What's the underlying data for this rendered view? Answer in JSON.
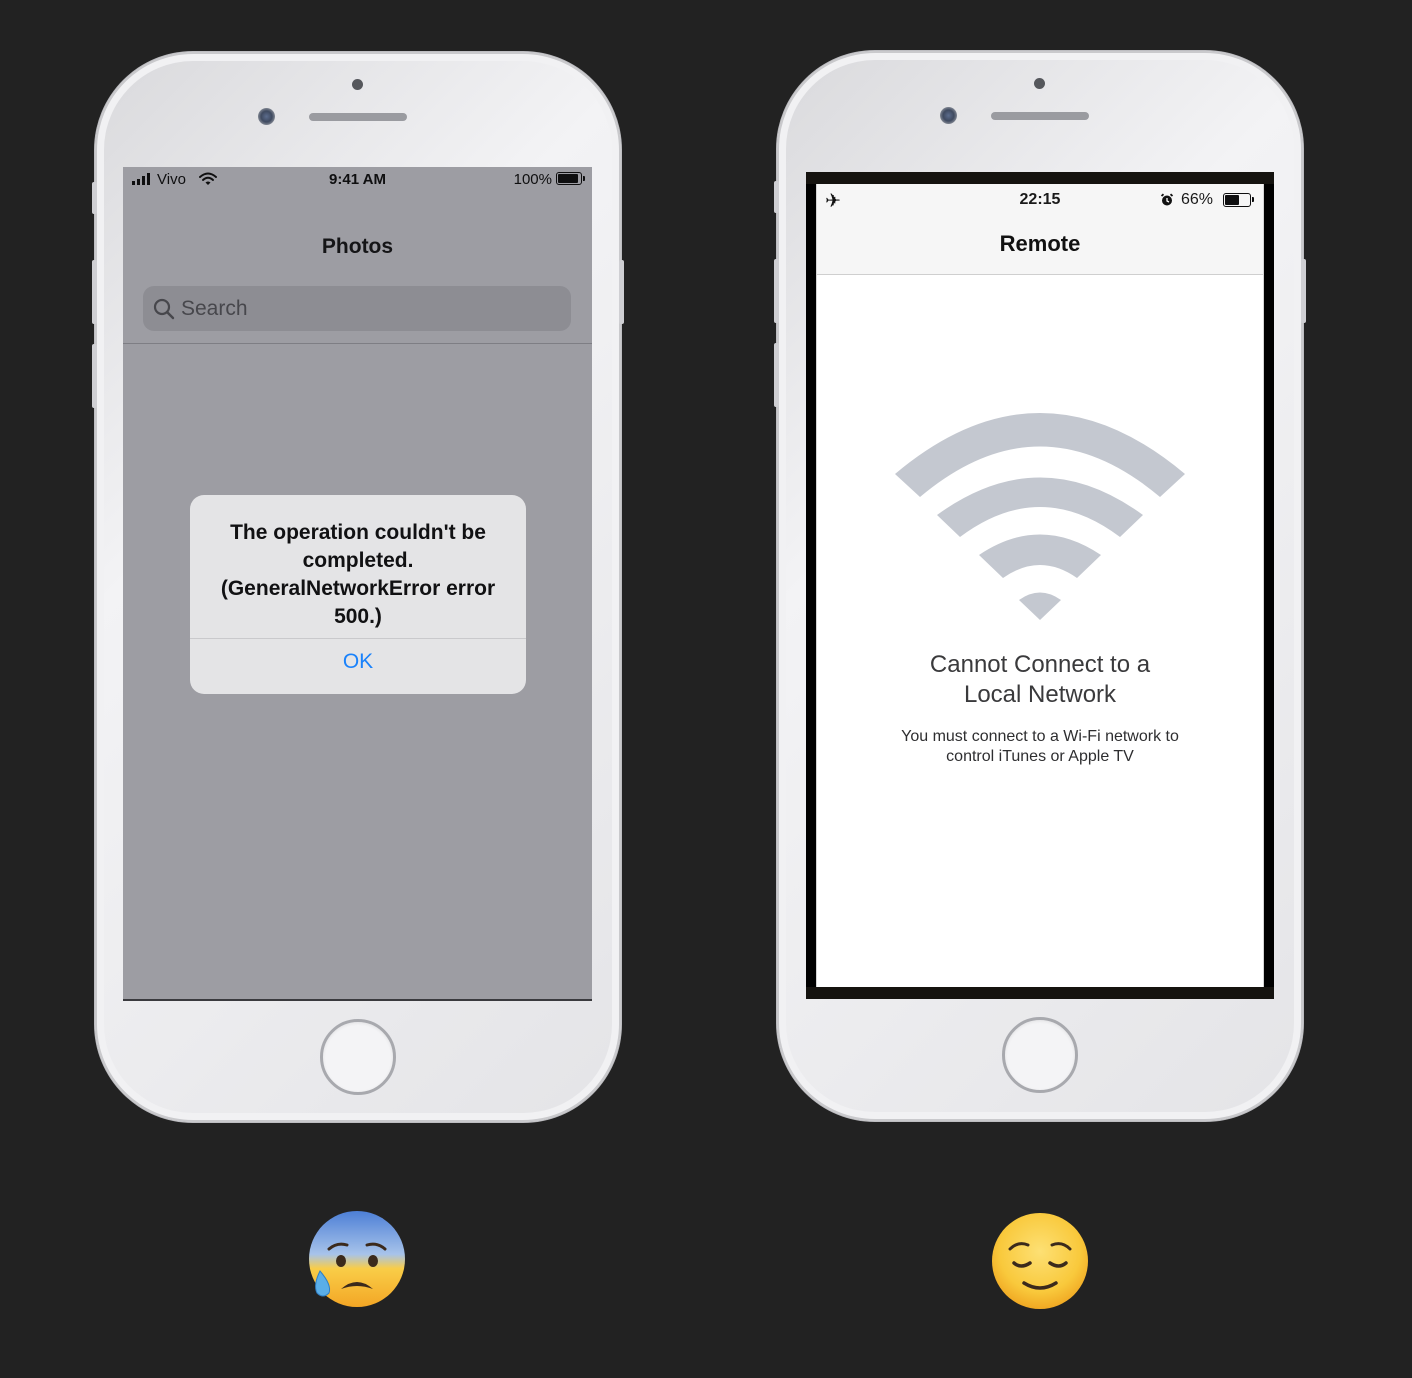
{
  "left_phone": {
    "status_bar": {
      "carrier": "Vivo",
      "time": "9:41 AM",
      "battery_percent": "100%",
      "battery_level": 1.0
    },
    "nav_title": "Photos",
    "search": {
      "placeholder": "Search"
    },
    "alert": {
      "message": "The operation couldn't be completed. (GeneralNetworkError error 500.)",
      "ok_label": "OK"
    },
    "reaction": "anxious-face-with-sweat-icon"
  },
  "right_phone": {
    "status_bar": {
      "time": "22:15",
      "battery_percent": "66%",
      "battery_level": 0.66
    },
    "nav_title": "Remote",
    "error_title": "Cannot Connect to a Local Network",
    "error_message": "You must connect to a Wi-Fi network to control iTunes or Apple TV",
    "reaction": "relieved-face-icon"
  },
  "colors": {
    "background": "#222222",
    "ios_blue": "#1a82fb",
    "dimmed_screen": "#9d9da3",
    "wifi_gray": "#c4c8d0"
  }
}
